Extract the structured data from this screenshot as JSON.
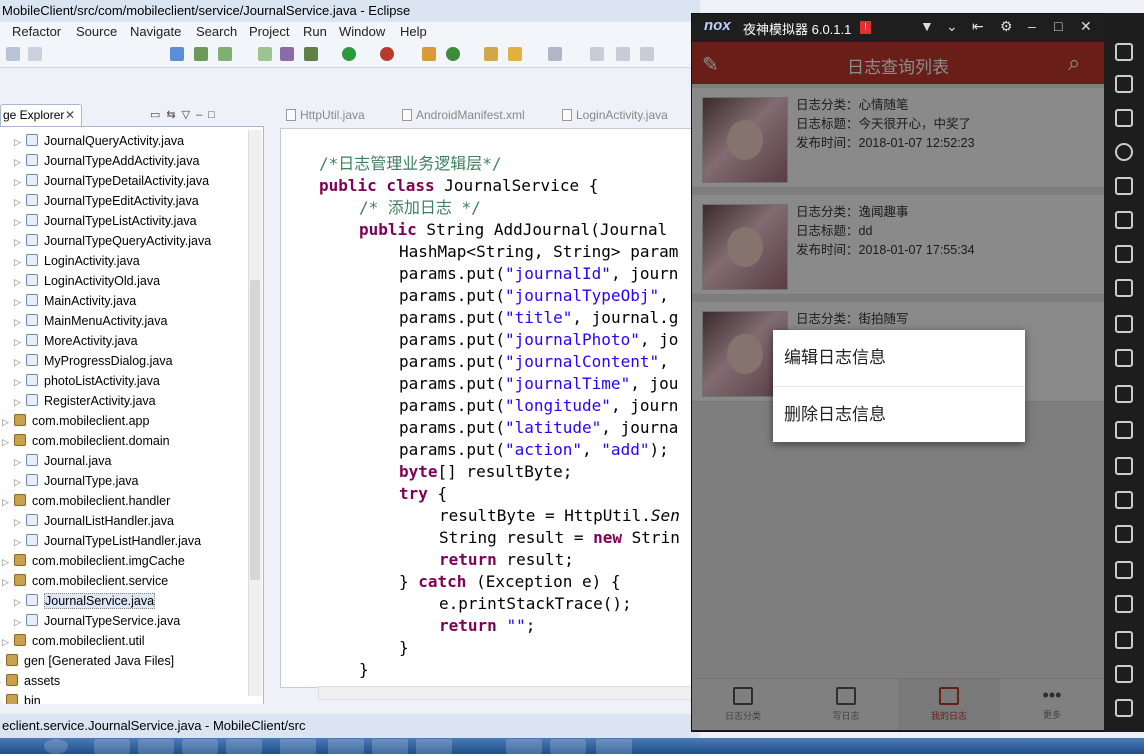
{
  "eclipse": {
    "title": "MobileClient/src/com/mobileclient/service/JournalService.java - Eclipse",
    "menu": [
      "Refactor",
      "Source",
      "Navigate",
      "Search",
      "Project",
      "Run",
      "Window",
      "Help"
    ],
    "explorer_tab": "ge Explorer",
    "tree": [
      {
        "label": "JournalQueryActivity.java",
        "type": "java",
        "indent": 1
      },
      {
        "label": "JournalTypeAddActivity.java",
        "type": "java",
        "indent": 1
      },
      {
        "label": "JournalTypeDetailActivity.java",
        "type": "java",
        "indent": 1
      },
      {
        "label": "JournalTypeEditActivity.java",
        "type": "java",
        "indent": 1
      },
      {
        "label": "JournalTypeListActivity.java",
        "type": "java",
        "indent": 1
      },
      {
        "label": "JournalTypeQueryActivity.java",
        "type": "java",
        "indent": 1
      },
      {
        "label": "LoginActivity.java",
        "type": "java",
        "indent": 1
      },
      {
        "label": "LoginActivityOld.java",
        "type": "java",
        "indent": 1
      },
      {
        "label": "MainActivity.java",
        "type": "java",
        "indent": 1
      },
      {
        "label": "MainMenuActivity.java",
        "type": "java",
        "indent": 1
      },
      {
        "label": "MoreActivity.java",
        "type": "java",
        "indent": 1
      },
      {
        "label": "MyProgressDialog.java",
        "type": "java",
        "indent": 1
      },
      {
        "label": "photoListActivity.java",
        "type": "java",
        "indent": 1
      },
      {
        "label": "RegisterActivity.java",
        "type": "java",
        "indent": 1
      },
      {
        "label": "com.mobileclient.app",
        "type": "pkg",
        "indent": 0
      },
      {
        "label": "com.mobileclient.domain",
        "type": "pkg",
        "indent": 0
      },
      {
        "label": "Journal.java",
        "type": "java",
        "indent": 1
      },
      {
        "label": "JournalType.java",
        "type": "java",
        "indent": 1
      },
      {
        "label": "com.mobileclient.handler",
        "type": "pkg",
        "indent": 0
      },
      {
        "label": "JournalListHandler.java",
        "type": "java",
        "indent": 1
      },
      {
        "label": "JournalTypeListHandler.java",
        "type": "java",
        "indent": 1
      },
      {
        "label": "com.mobileclient.imgCache",
        "type": "pkg",
        "indent": 0
      },
      {
        "label": "com.mobileclient.service",
        "type": "pkg",
        "indent": 0
      },
      {
        "label": "JournalService.java",
        "type": "java",
        "indent": 1,
        "selected": true
      },
      {
        "label": "JournalTypeService.java",
        "type": "java",
        "indent": 1
      },
      {
        "label": "com.mobileclient.util",
        "type": "pkg",
        "indent": 0
      },
      {
        "label": "gen [Generated Java Files]",
        "type": "pkg",
        "indent": -1
      },
      {
        "label": "assets",
        "type": "pkg",
        "indent": -1
      },
      {
        "label": "bin",
        "type": "pkg",
        "indent": -1
      }
    ],
    "editor_tabs": [
      "HttpUtil.java",
      "AndroidManifest.xml",
      "LoginActivity.java"
    ],
    "status": "eclient.service.JournalService.java - MobileClient/src"
  },
  "nox": {
    "logo": "nox",
    "title": "夜神模拟器 6.0.1.1",
    "warn": "!",
    "screen_title": "日志查询列表",
    "journals": [
      {
        "category": "日志分类：心情随笔",
        "title": "日志标题：今天很开心，中奖了",
        "time": "发布时间：2018-01-07 12:52:23"
      },
      {
        "category": "日志分类：逸闻趣事",
        "title": "日志标题：dd",
        "time": "发布时间：2018-01-07 17:55:34"
      },
      {
        "category": "日志分类：街拍随写",
        "title": "",
        "time": ""
      }
    ],
    "popup": [
      "编辑日志信息",
      "删除日志信息"
    ],
    "bottom_nav": [
      "日志分类",
      "写日志",
      "我的日志",
      "更多"
    ],
    "active_tab": 2
  }
}
